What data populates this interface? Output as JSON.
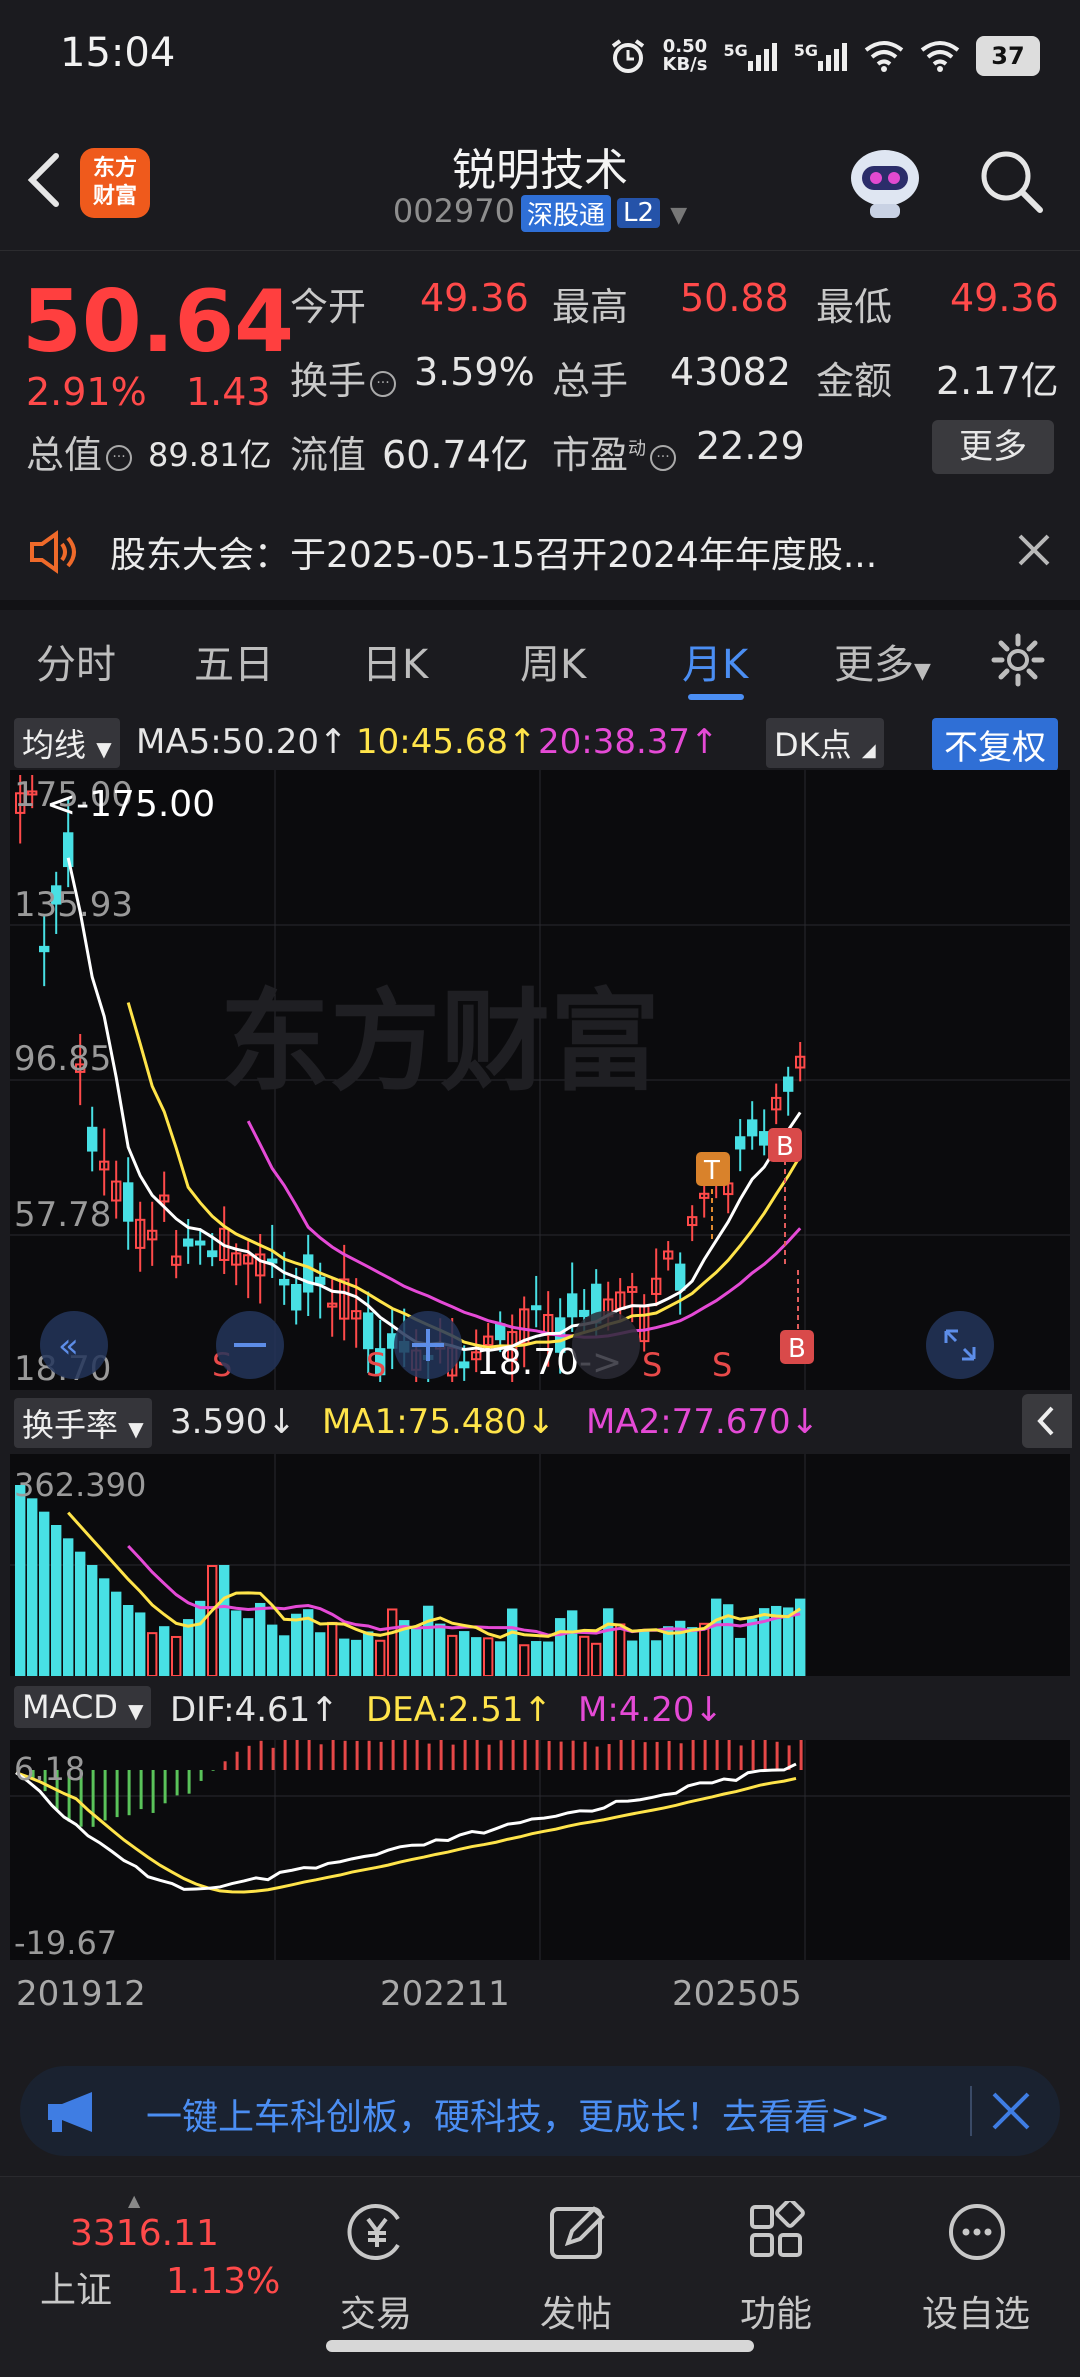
{
  "status_bar": {
    "time": "15:04",
    "net_speed_top": "0.50",
    "net_speed_bottom": "KB/s",
    "sig1": "5G",
    "sig2": "5G",
    "battery": "37"
  },
  "header": {
    "stock_name": "锐明技术",
    "stock_code": "002970",
    "exchange_badge": "深股通",
    "level_badge": "L2",
    "logo_line1": "东方",
    "logo_line2": "财富"
  },
  "quote": {
    "price": "50.64",
    "change_pct": "2.91%",
    "change_abs": "1.43",
    "open_label": "今开",
    "open": "49.36",
    "high_label": "最高",
    "high": "50.88",
    "low_label": "最低",
    "low": "49.36",
    "turnover_label": "换手",
    "turnover": "3.59%",
    "volume_label": "总手",
    "volume": "43082",
    "amount_label": "金额",
    "amount": "2.17亿",
    "mktcap_label": "总值",
    "mktcap": "89.81亿",
    "float_label": "流值",
    "float_cap": "60.74亿",
    "pe_label": "市盈",
    "pe_sup": "动",
    "pe": "22.29",
    "more": "更多"
  },
  "notice": {
    "text": "股东大会：于2025-05-15召开2024年年度股..."
  },
  "tabs": [
    "分时",
    "五日",
    "日K",
    "周K",
    "月K",
    "更多"
  ],
  "active_tab": 4,
  "main_chart": {
    "indicator_select": "均线",
    "ma5": "MA5:50.20",
    "ma10": "10:45.68",
    "ma20": "20:38.37",
    "dk_select": "DK点",
    "adjust_btn": "不复权",
    "y_labels": [
      "175.00",
      "135.93",
      "96.85",
      "57.78",
      "18.70"
    ],
    "max_label": "<-175.00",
    "min_label": "18.70->",
    "watermark": "东方财富",
    "markers": {
      "t": "T",
      "b": "B",
      "s": "S"
    }
  },
  "volume_chart": {
    "indicator_select": "换手率",
    "value": "3.590",
    "ma1": "MA1:75.480",
    "ma2": "MA2:77.670",
    "y_top": "362.390"
  },
  "macd_chart": {
    "indicator_select": "MACD",
    "dif": "DIF:4.61",
    "dea": "DEA:2.51",
    "m": "M:4.20",
    "y_top": "6.18",
    "y_bottom": "-19.67",
    "x_labels": [
      "201912",
      "202211",
      "202505"
    ]
  },
  "banner": {
    "text": "一键上车科创板，硬科技，更成长！去看看>>"
  },
  "bottom_nav": {
    "index_value": "3316.11",
    "index_name": "上证",
    "index_change": "1.13%",
    "items": [
      "交易",
      "发帖",
      "功能",
      "设自选"
    ]
  },
  "colors": {
    "up": "#ff4a4a",
    "down": "#48e0e4",
    "accent": "#4b8ef3",
    "ma5": "#ffffff",
    "ma10": "#ffe44a",
    "ma20": "#e54ad6"
  }
}
